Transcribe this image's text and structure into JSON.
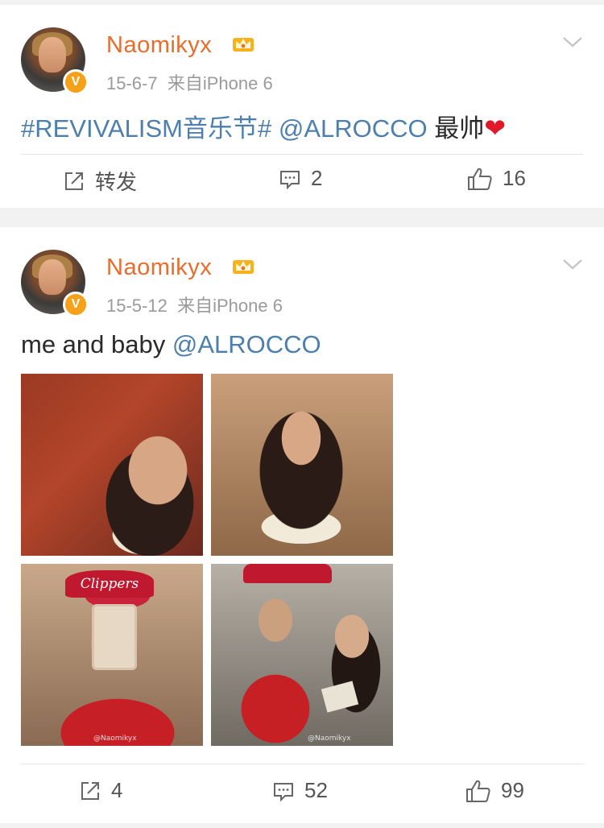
{
  "posts": [
    {
      "username": "Naomikyx",
      "date": "15-6-7",
      "source": "来自iPhone 6",
      "text_hashtag": "#REVIVALISM音乐节#",
      "text_mention": "@ALROCCO",
      "text_suffix": "最帅",
      "text_emoji": "❤",
      "actions": {
        "repost": "转发",
        "comments": "2",
        "likes": "16"
      }
    },
    {
      "username": "Naomikyx",
      "date": "15-5-12",
      "source": "来自iPhone 6",
      "text_plain": "me and baby",
      "text_mention": "@ALROCCO",
      "photo_watermarks": [
        "@Naomikyx",
        "@Naomikyx"
      ],
      "photo_cap_text": "Clippers",
      "actions": {
        "repost": "4",
        "comments": "52",
        "likes": "99"
      }
    }
  ],
  "icons": {
    "vip_crown": "crown-icon",
    "verified": "verified-badge-icon",
    "menu": "chevron-down-icon",
    "repost": "repost-icon",
    "comment": "comment-icon",
    "like": "thumbs-up-icon"
  },
  "verified_badge_letter": "V",
  "colors": {
    "username": "#e86d2d",
    "link": "#4c7fae",
    "meta": "#9a9a9a",
    "heart": "#e0182a",
    "verified": "#f7a01a"
  }
}
